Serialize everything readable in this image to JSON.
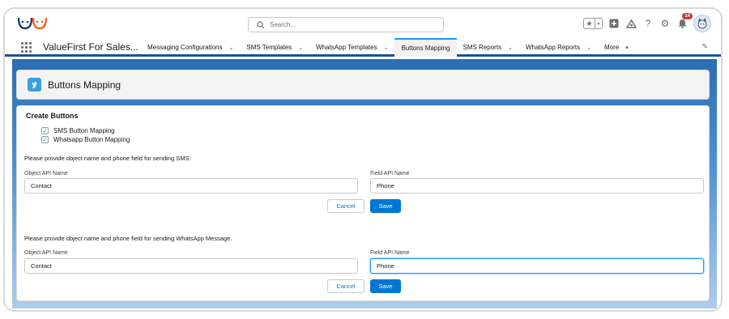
{
  "header": {
    "search_placeholder": "Search...",
    "notification_count": "14"
  },
  "nav": {
    "app_name": "ValueFirst For Sales...",
    "tabs": [
      {
        "label": "Messaging Configurations",
        "chevron": "⌄"
      },
      {
        "label": "SMS Templates",
        "chevron": "⌄"
      },
      {
        "label": "WhatsApp Templates",
        "chevron": "⌄"
      },
      {
        "label": "Buttons Mapping",
        "chevron": ""
      },
      {
        "label": "SMS Reports",
        "chevron": "⌄"
      },
      {
        "label": "WhatsApp Reports",
        "chevron": "⌄"
      },
      {
        "label": "More",
        "chevron": "▾"
      }
    ]
  },
  "page_header": {
    "title": "Buttons Mapping"
  },
  "card": {
    "title": "Create Buttons",
    "checkbox_sms": "SMS Button Mapping",
    "checkbox_whatsapp": "Whatsapp Button Mapping",
    "sms_section": {
      "note": "Please provide object name and phone field for sending SMS.",
      "object_label": "Object API Name",
      "object_value": "Contact",
      "field_label": "Field API Name",
      "field_value": "Phone",
      "cancel": "Cancel",
      "save": "Save"
    },
    "whatsapp_section": {
      "note": "Please provide object name and phone field for sending WhatsApp Message.",
      "object_label": "Object API Name",
      "object_value": "Contact",
      "field_label": "Field API Name",
      "field_value": "Phone",
      "cancel": "Cancel",
      "save": "Save"
    }
  },
  "colors": {
    "brand_blue": "#0176d3",
    "nav_underline": "#1b5297",
    "badge_red": "#c23934"
  }
}
